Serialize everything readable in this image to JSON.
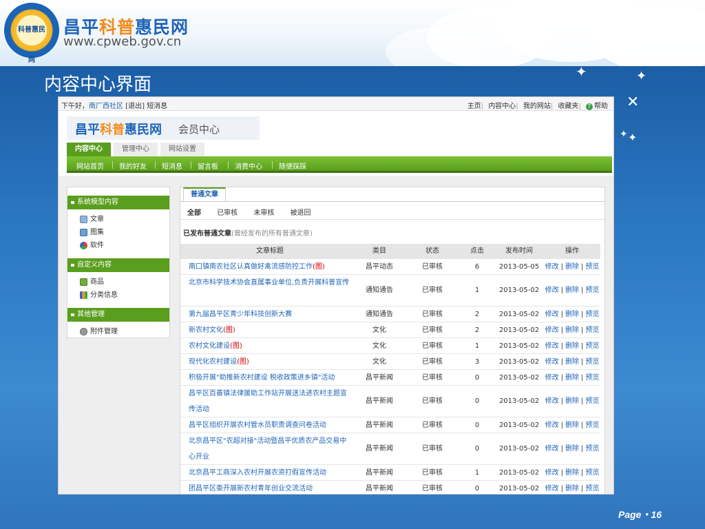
{
  "slide": {
    "logo": {
      "title_prefix": "昌平",
      "title_highlight": "科普",
      "title_suffix": "惠民网",
      "url": "www.cpweb.gov.cn",
      "badge_text": "科普惠民网"
    },
    "heading": "内容中心界面",
    "page_label": "Page・16"
  },
  "topbar": {
    "greeting": "下午好，",
    "username": "南厂西社区",
    "logout": "[退出]",
    "messages": "短消息",
    "links": [
      "主页",
      "内容中心",
      "我的网站",
      "收藏夹",
      "帮助"
    ]
  },
  "header": {
    "title_prefix": "昌平",
    "title_highlight": "科普",
    "title_suffix": "惠民网",
    "subtitle": "会员中心"
  },
  "tabs": [
    "内容中心",
    "管理中心",
    "网站设置"
  ],
  "nav": [
    "网站首页",
    "我的好友",
    "短消息",
    "留言板",
    "消费中心",
    "随便踩踩"
  ],
  "sidebar": {
    "sections": [
      {
        "title": "系统模型内容",
        "items": [
          "文章",
          "图集",
          "软件"
        ]
      },
      {
        "title": "自定义内容",
        "items": [
          "商品",
          "分类信息"
        ]
      },
      {
        "title": "其他管理",
        "items": [
          "附件管理"
        ]
      }
    ]
  },
  "main": {
    "tab": "普通文章",
    "filters": [
      "全部",
      "已审核",
      "未审核",
      "被退回"
    ],
    "section_title": "已发布普通文章",
    "section_note": "(曾经发布的所有普通文章)",
    "columns": [
      "文章标题",
      "类目",
      "状态",
      "点击",
      "发布时间",
      "操作"
    ],
    "ops": [
      "修改",
      "删除",
      "预览"
    ],
    "rows": [
      {
        "title": "南口镇南农社区认真做好禽流感防控工作",
        "tag": "(图)",
        "category": "昌平动态",
        "status": "已审核",
        "clicks": "6",
        "date": "2013-05-05"
      },
      {
        "title": "北京市科学技术协会直属事业单位,负责开展科普宣传",
        "tag": "",
        "category": "通知通告",
        "status": "已审核",
        "clicks": "1",
        "date": "2013-05-02"
      },
      {
        "title": "第九届昌平区青少年科技创新大赛",
        "tag": "",
        "category": "通知通告",
        "status": "已审核",
        "clicks": "2",
        "date": "2013-05-02"
      },
      {
        "title": "新农村文化",
        "tag": "(图)",
        "category": "文化",
        "status": "已审核",
        "clicks": "2",
        "date": "2013-05-02"
      },
      {
        "title": "农村文化建设",
        "tag": "(图)",
        "category": "文化",
        "status": "已审核",
        "clicks": "1",
        "date": "2013-05-02"
      },
      {
        "title": "现代化农村建设",
        "tag": "(图)",
        "category": "文化",
        "status": "已审核",
        "clicks": "3",
        "date": "2013-05-02"
      },
      {
        "title": "积极开展\"助推新农村建设 税收政策进乡镇\"活动",
        "tag": "",
        "category": "昌平新闻",
        "status": "已审核",
        "clicks": "0",
        "date": "2013-05-02"
      },
      {
        "title": "昌平区百善镇法律援助工作站开展送法进农村主题宣传活动",
        "tag": "",
        "category": "昌平新闻",
        "status": "已审核",
        "clicks": "0",
        "date": "2013-05-02"
      },
      {
        "title": "昌平区组织开展农村管水员职责调查问卷活动",
        "tag": "",
        "category": "昌平新闻",
        "status": "已审核",
        "clicks": "0",
        "date": "2013-05-02"
      },
      {
        "title": "北京昌平区\"农超对接\"活动暨昌平优质农产品交易中心开业",
        "tag": "",
        "category": "昌平新闻",
        "status": "已审核",
        "clicks": "0",
        "date": "2013-05-02"
      },
      {
        "title": "北京昌平工商深入农村开展农资打假宣传活动",
        "tag": "",
        "category": "昌平新闻",
        "status": "已审核",
        "clicks": "1",
        "date": "2013-05-02"
      },
      {
        "title": "团昌平区委开展新农村青年创业交流活动",
        "tag": "",
        "category": "昌平新闻",
        "status": "已审核",
        "clicks": "0",
        "date": "2013-05-02"
      }
    ]
  }
}
